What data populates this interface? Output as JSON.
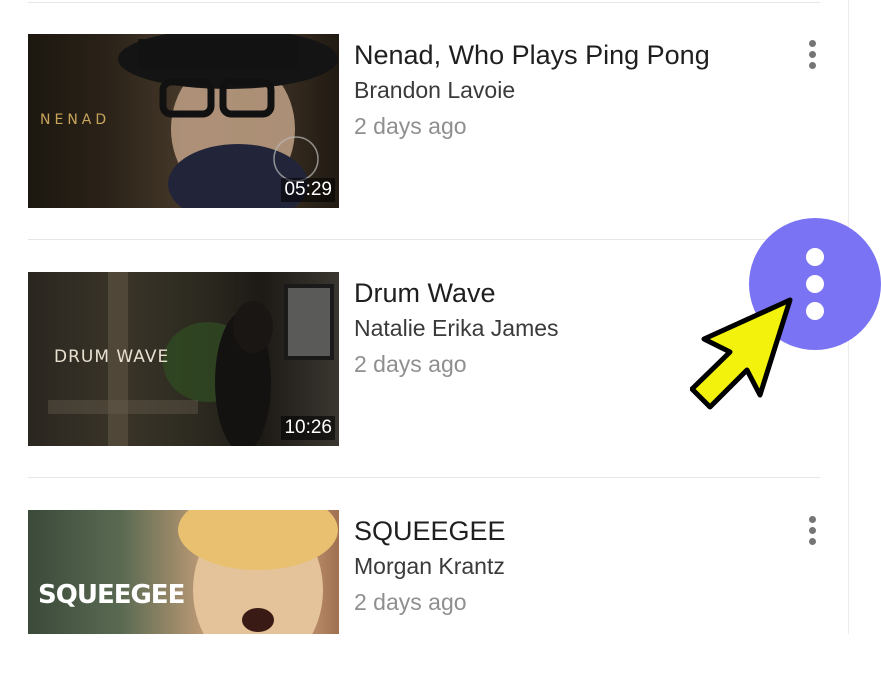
{
  "videos": [
    {
      "title": "Nenad, Who Plays Ping Pong",
      "channel": "Brandon Lavoie",
      "age": "2 days ago",
      "duration": "05:29",
      "thumb_text": "NENAD"
    },
    {
      "title": "Drum Wave",
      "channel": "Natalie Erika James",
      "age": "2 days ago",
      "duration": "10:26",
      "thumb_text": "DRUM WAVE"
    },
    {
      "title": "SQUEEGEE",
      "channel": "Morgan Krantz",
      "age": "2 days ago",
      "duration": "",
      "thumb_text": "SQUEEGEE"
    }
  ],
  "colors": {
    "highlight": "#7a74f4",
    "arrow": "#f2f20c",
    "kebab": "#757575"
  },
  "icons": {
    "menu": "more-vert-icon",
    "pointer": "arrow-pointer-icon"
  }
}
